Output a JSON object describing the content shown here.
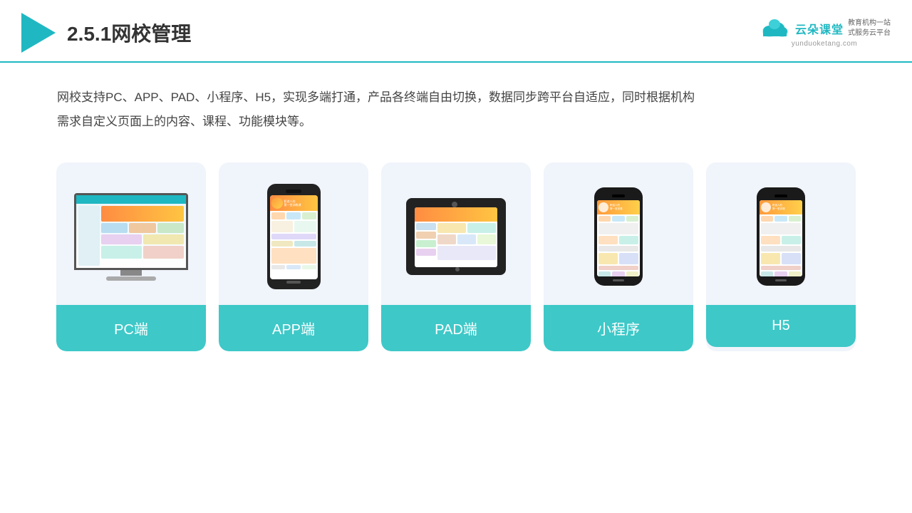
{
  "header": {
    "title": "2.5.1网校管理",
    "logo_name": "云朵课堂",
    "logo_url": "yunduoketang.com",
    "logo_tagline": "教育机构一站\n式服务云平台"
  },
  "description": "网校支持PC、APP、PAD、小程序、H5，实现多端打通，产品各终端自由切换，数据同步跨平台自适应，同时根据机构\n需求自定义页面上的内容、课程、功能模块等。",
  "cards": [
    {
      "id": "pc",
      "label": "PC端"
    },
    {
      "id": "app",
      "label": "APP端"
    },
    {
      "id": "pad",
      "label": "PAD端"
    },
    {
      "id": "miniprogram",
      "label": "小程序"
    },
    {
      "id": "h5",
      "label": "H5"
    }
  ]
}
